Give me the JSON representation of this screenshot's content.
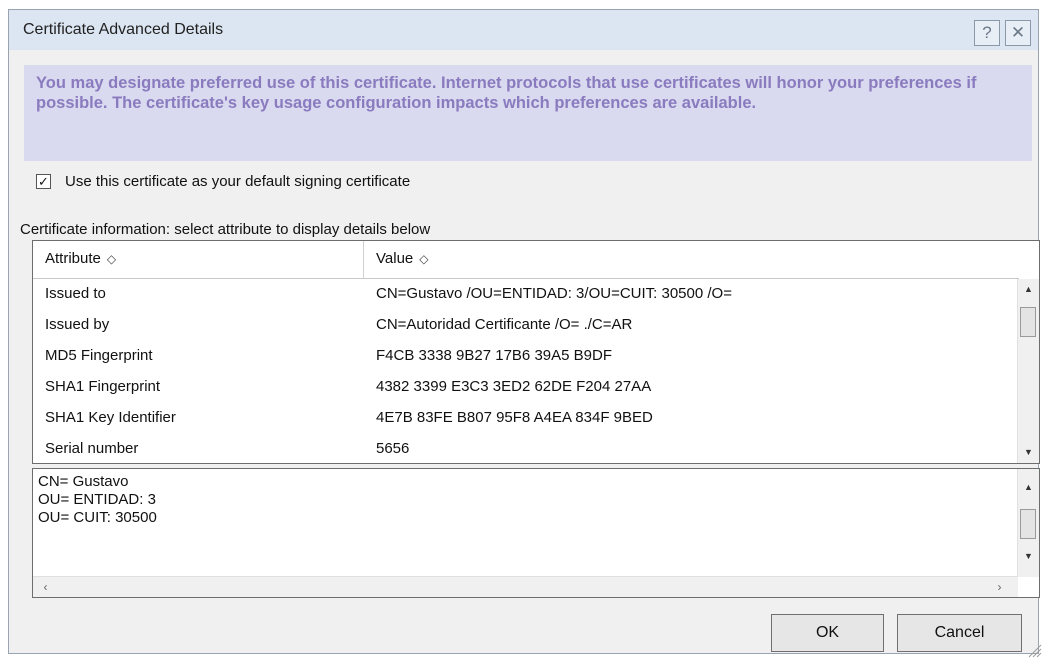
{
  "dialog": {
    "title": "Certificate Advanced Details",
    "help_label": "?",
    "close_label": "✕"
  },
  "banner": {
    "text": "You may designate preferred use of this certificate.  Internet protocols that use certificates will honor your preferences if possible.  The certificate's key usage configuration impacts which preferences are available."
  },
  "default_signing": {
    "checked": true,
    "label": "Use this certificate as your default signing certificate"
  },
  "info_label": "Certificate information:  select attribute to display details below",
  "table": {
    "headers": {
      "attribute": "Attribute",
      "value": "Value"
    },
    "rows": [
      {
        "attribute": "Issued to",
        "value": "CN=Gustavo                 /OU=ENTIDAD:  3/OU=CUIT: 30500          /O="
      },
      {
        "attribute": "Issued by",
        "value": "CN=Autoridad Certificante                         /O=       ./C=AR"
      },
      {
        "attribute": "MD5 Fingerprint",
        "value": "F4CB 3338 9B27 17B6 39A5 B9DF"
      },
      {
        "attribute": "SHA1 Fingerprint",
        "value": "4382 3399 E3C3 3ED2 62DE F204 27AA"
      },
      {
        "attribute": "SHA1 Key Identifier",
        "value": "4E7B 83FE B807 95F8 A4EA 834F 9BED"
      },
      {
        "attribute": "Serial number",
        "value": "5656"
      }
    ]
  },
  "details": {
    "lines": [
      "CN= Gustavo",
      "OU= ENTIDAD:  3",
      "OU= CUIT: 30500"
    ]
  },
  "buttons": {
    "ok": "OK",
    "cancel": "Cancel"
  }
}
